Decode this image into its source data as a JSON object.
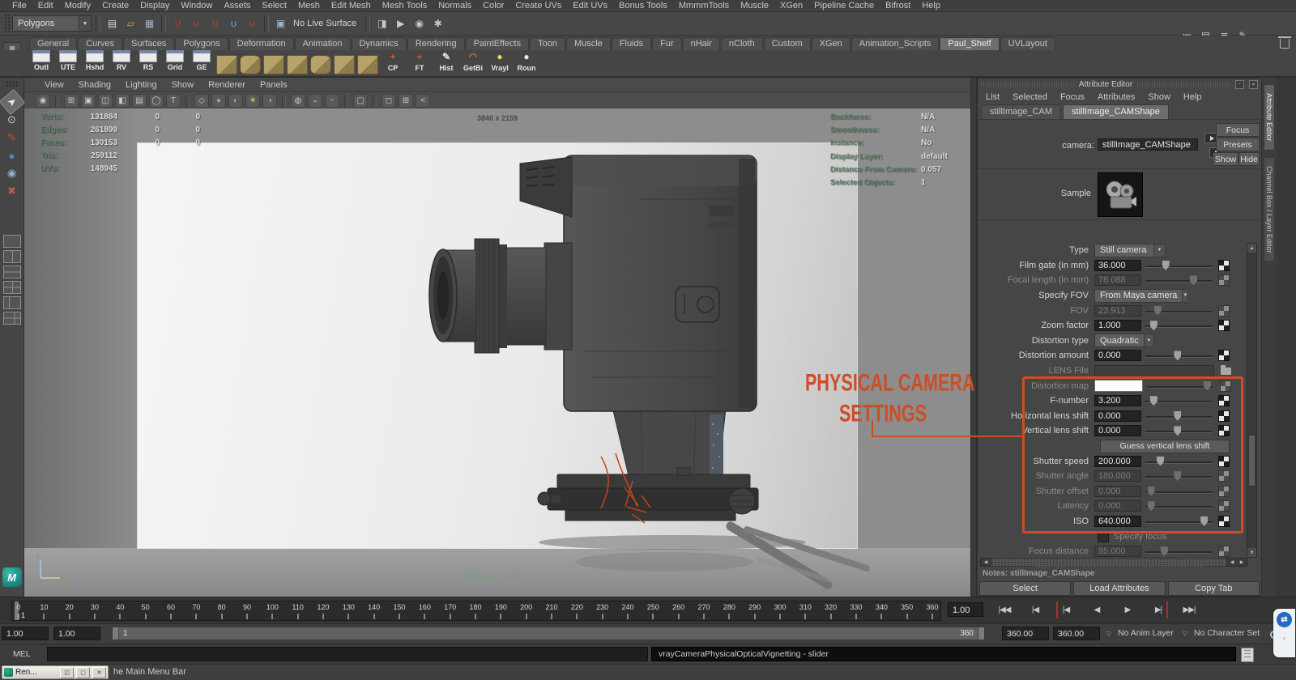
{
  "app": {
    "menu_bar": [
      "File",
      "Edit",
      "Modify",
      "Create",
      "Display",
      "Window",
      "Assets",
      "Select",
      "Mesh",
      "Edit Mesh",
      "Mesh Tools",
      "Normals",
      "Color",
      "Create UVs",
      "Edit UVs",
      "Bonus Tools",
      "MmmmTools",
      "Muscle",
      "XGen",
      "Pipeline Cache",
      "Bifrost",
      "Help"
    ],
    "toolbar": {
      "mode_dropdown": "Polygons",
      "live_surface_label": "No Live Surface"
    },
    "shelf": {
      "tabs": [
        "General",
        "Curves",
        "Surfaces",
        "Polygons",
        "Deformation",
        "Animation",
        "Dynamics",
        "Rendering",
        "PaintEffects",
        "Toon",
        "Muscle",
        "Fluids",
        "Fur",
        "nHair",
        "nCloth",
        "Custom",
        "XGen",
        "Animation_Scripts",
        "Paul_Shelf",
        "UVLayout"
      ],
      "active_tab": "Paul_Shelf",
      "panel_buttons": [
        "Outl",
        "UTE",
        "Hshd",
        "RV",
        "RS",
        "Grid",
        "GE"
      ],
      "crate_count": 7,
      "tool_buttons": [
        {
          "label": "CP",
          "icon": "axis-icon"
        },
        {
          "label": "FT",
          "icon": "axis-icon"
        },
        {
          "label": "Hist",
          "icon": "pencil-icon"
        },
        {
          "label": "GetBi",
          "icon": "curve-icon"
        },
        {
          "label": "VrayI",
          "icon": "bulb-icon"
        },
        {
          "label": "Roun",
          "icon": "penguin-icon"
        }
      ]
    }
  },
  "viewport": {
    "menu": [
      "View",
      "Shading",
      "Lighting",
      "Show",
      "Renderer",
      "Panels"
    ],
    "resolution": "3840 x 2159",
    "camera_name": "stillImage_CAM",
    "hud_left": [
      {
        "label": "Verts:",
        "cols": [
          "131884",
          "0",
          "0"
        ]
      },
      {
        "label": "Edges:",
        "cols": [
          "261899",
          "0",
          "0"
        ]
      },
      {
        "label": "Faces:",
        "cols": [
          "130153",
          "0",
          "0"
        ]
      },
      {
        "label": "Tris:",
        "cols": [
          "259112"
        ]
      },
      {
        "label": "UVs:",
        "cols": [
          "148945"
        ]
      }
    ],
    "hud_right": [
      {
        "label": "Backfaces:",
        "value": "N/A"
      },
      {
        "label": "Smoothness:",
        "value": "N/A"
      },
      {
        "label": "Instance:",
        "value": "No"
      },
      {
        "label": "Display Layer:",
        "value": "default"
      },
      {
        "label": "Distance From Camera:",
        "value": "0.057"
      },
      {
        "label": "Selected Objects:",
        "value": "1"
      }
    ]
  },
  "annotation": {
    "line1": "PHYSICAL CAMERA",
    "line2": "SETTINGS",
    "accent_color": "#cb4e27"
  },
  "attribute_editor": {
    "title": "Attribute Editor",
    "menu": [
      "List",
      "Selected",
      "Focus",
      "Attributes",
      "Show",
      "Help"
    ],
    "tabs": [
      "stillImage_CAM",
      "stillImage_CAMShape"
    ],
    "active_tab": "stillImage_CAMShape",
    "camera_label": "camera:",
    "camera_value": "stillImage_CAMShape",
    "focus_button": "Focus",
    "presets_button": "Presets",
    "show_button": "Show",
    "hide_button": "Hide",
    "sample_label": "Sample",
    "rows": [
      {
        "label": "Type",
        "control": "dropdown",
        "value": "Still camera",
        "enabled": true,
        "dd_width": 86
      },
      {
        "label": "Film gate (in mm)",
        "control": "slider",
        "value": "36.000",
        "enabled": true,
        "pos": 30
      },
      {
        "label": "Focal length (in mm)",
        "control": "slider",
        "value": "78.088",
        "enabled": false,
        "pos": 72
      },
      {
        "label": "Specify FOV",
        "control": "dropdown",
        "value": "From Maya camera",
        "enabled": true,
        "dd_width": 112
      },
      {
        "label": "FOV",
        "control": "slider",
        "value": "23.913",
        "enabled": false,
        "pos": 18
      },
      {
        "label": "Zoom factor",
        "control": "slider",
        "value": "1.000",
        "enabled": true,
        "pos": 12
      },
      {
        "label": "Distortion type",
        "control": "dropdown",
        "value": "Quadratic",
        "enabled": true,
        "dd_width": 72
      },
      {
        "label": "Distortion amount",
        "control": "slider",
        "value": "0.000",
        "enabled": true,
        "pos": 48
      },
      {
        "label": "LENS File",
        "control": "file",
        "value": "",
        "enabled": false
      },
      {
        "label": "Distortion map",
        "control": "swatch",
        "value": "",
        "enabled": false,
        "pos": 90
      },
      {
        "label": "F-number",
        "control": "slider",
        "value": "3.200",
        "enabled": true,
        "pos": 12
      },
      {
        "label": "Horizontal lens shift",
        "control": "slider",
        "value": "0.000",
        "enabled": true,
        "pos": 48
      },
      {
        "label": "Vertical lens shift",
        "control": "slider",
        "value": "0.000",
        "enabled": true,
        "pos": 48
      },
      {
        "label": "Guess vertical lens shift",
        "control": "button",
        "enabled": true
      },
      {
        "label": "Shutter speed",
        "control": "slider",
        "value": "200.000",
        "enabled": true,
        "pos": 22
      },
      {
        "label": "Shutter angle",
        "control": "slider",
        "value": "180.000",
        "enabled": false,
        "pos": 48
      },
      {
        "label": "Shutter offset",
        "control": "slider",
        "value": "0.000",
        "enabled": false,
        "pos": 8
      },
      {
        "label": "Latency",
        "control": "slider",
        "value": "0.000",
        "enabled": false,
        "pos": 8
      },
      {
        "label": "ISO",
        "control": "slider",
        "value": "640.000",
        "enabled": true,
        "pos": 88
      },
      {
        "label": "Specify focus",
        "control": "checkbox",
        "enabled": false
      },
      {
        "label": "Focus distance",
        "control": "slider",
        "value": "95.000",
        "enabled": false,
        "pos": 28
      }
    ],
    "notes": "Notes: stillImage_CAMShape",
    "footer_buttons": [
      "Select",
      "Load Attributes",
      "Copy Tab"
    ]
  },
  "side_tabs": [
    "Attribute Editor",
    "Channel Box / Layer Editor"
  ],
  "time_slider": {
    "tick_start": 0,
    "tick_end": 360,
    "tick_step": 10,
    "current_frame": "1",
    "current_time_field": "1.00"
  },
  "range_slider": {
    "playback_start": "1.00",
    "anim_start": "1.00",
    "range_start": "1",
    "range_end": "360",
    "anim_end": "360.00",
    "playback_end": "360.00",
    "anim_layer": "No Anim Layer",
    "character_set": "No Character Set"
  },
  "command_line": {
    "label": "MEL",
    "help_text": "vrayCameraPhysicalOpticalVignetting - slider"
  },
  "taskbar": {
    "window_title": "Ren...",
    "status_text": "he Main Menu Bar"
  },
  "icons": {
    "dropdown_arrow": "▼",
    "file_group": [
      [
        "new-scene-icon",
        "▤",
        "#dcdcdc"
      ],
      [
        "open-scene-icon",
        "▱",
        "#d9a33c"
      ],
      [
        "save-scene-icon",
        "▦",
        "#9fb4c8"
      ]
    ],
    "snap_group": [
      [
        "snap-grid-icon",
        "∪",
        "#c0392b"
      ],
      [
        "snap-curve-icon",
        "∪",
        "#c0392b"
      ],
      [
        "snap-point-icon",
        "∪",
        "#c0392b"
      ],
      [
        "snap-plane-icon",
        "∪",
        "#5dade2"
      ],
      [
        "snap-surface-icon",
        "∪",
        "#c0392b"
      ]
    ],
    "render_group": [
      [
        "construction-history-icon",
        "◨",
        "#c9c9c9"
      ],
      [
        "render-icon",
        "▶",
        "#c9c9c9"
      ],
      [
        "ipr-render-icon",
        "◉",
        "#c9c9c9"
      ],
      [
        "render-settings-icon",
        "✱",
        "#c9c9c9"
      ]
    ],
    "topbar_right": [
      [
        "outliner-icon",
        "≔",
        "#c9c9c9"
      ],
      [
        "clipboard-icon",
        "▤",
        "#c9c9c9"
      ],
      [
        "list-icon",
        "≣",
        "#c9c9c9"
      ],
      [
        "notes-icon",
        "✎",
        "#c9c9c9"
      ]
    ],
    "viewport_toolbar": [
      [
        "camera-select-icon",
        "◉",
        ""
      ],
      [
        "sep",
        "",
        ""
      ],
      [
        "grid-icon",
        "⊞",
        ""
      ],
      [
        "film-gate-icon",
        "▣",
        ""
      ],
      [
        "resolution-gate-icon",
        "◫",
        ""
      ],
      [
        "gate-mask-icon",
        "◧",
        ""
      ],
      [
        "field-chart-icon",
        "▤",
        ""
      ],
      [
        "safe-action-icon",
        "◯",
        ""
      ],
      [
        "safe-title-icon",
        "T",
        ""
      ],
      [
        "sep",
        "",
        ""
      ],
      [
        "wireframe-icon",
        "◇",
        ""
      ],
      [
        "smooth-shade-icon",
        "●",
        "#7fa7cc"
      ],
      [
        "textured-icon",
        "◐",
        "#7fa7cc"
      ],
      [
        "use-lights-icon",
        "☀",
        "#e8d44d"
      ],
      [
        "shadows-icon",
        "◑",
        "#8fa7c0"
      ],
      [
        "sep",
        "",
        ""
      ],
      [
        "default-material-icon",
        "◍",
        ""
      ],
      [
        "xray-icon",
        "◒",
        "#cc8844"
      ],
      [
        "backface-icon",
        "◓",
        "#7788cc"
      ],
      [
        "sep",
        "",
        ""
      ],
      [
        "isolate-select-icon",
        "▢",
        ""
      ],
      [
        "sep",
        "",
        ""
      ],
      [
        "single-pane-icon",
        "◻",
        ""
      ],
      [
        "multi-pane-icon",
        "⊞",
        ""
      ],
      [
        "outliner-toggle-icon",
        "<",
        ""
      ]
    ],
    "toolbox": [
      [
        "select-tool-icon",
        "➤",
        "#e8e8e8",
        1
      ],
      [
        "lasso-tool-icon",
        "⊙",
        "#d0d0d0",
        0
      ],
      [
        "paint-select-tool-icon",
        "✎",
        "#cc4a3a",
        0
      ],
      [
        "move-tool-icon",
        "●",
        "#4a86c8",
        0
      ],
      [
        "rotate-tool-icon",
        "◉",
        "#8fb4d8",
        0
      ],
      [
        "scale-tool-icon",
        "✖",
        "#c05a4a",
        0
      ]
    ],
    "shelf_tool_glyphs": {
      "axis-icon": [
        "+",
        "#cc5544"
      ],
      "pencil-icon": [
        "✎",
        "#e8e0d0"
      ],
      "curve-icon": [
        "◠",
        "#cc7a3a"
      ],
      "bulb-icon": [
        "●",
        "#e8d84a"
      ],
      "penguin-icon": [
        "●",
        "#e8e8e8"
      ]
    },
    "playback": [
      {
        "name": "go-to-start",
        "glyph": "|◀◀"
      },
      {
        "name": "step-back-frame",
        "glyph": "|◀"
      },
      {
        "name": "step-back-key",
        "glyph": "|◀",
        "red": "left"
      },
      {
        "name": "play-backwards",
        "glyph": "◀"
      },
      {
        "name": "play-forward",
        "glyph": "▶"
      },
      {
        "name": "step-forward-key",
        "glyph": "▶|",
        "red": "right"
      },
      {
        "name": "go-to-end",
        "glyph": "▶▶|"
      }
    ]
  }
}
